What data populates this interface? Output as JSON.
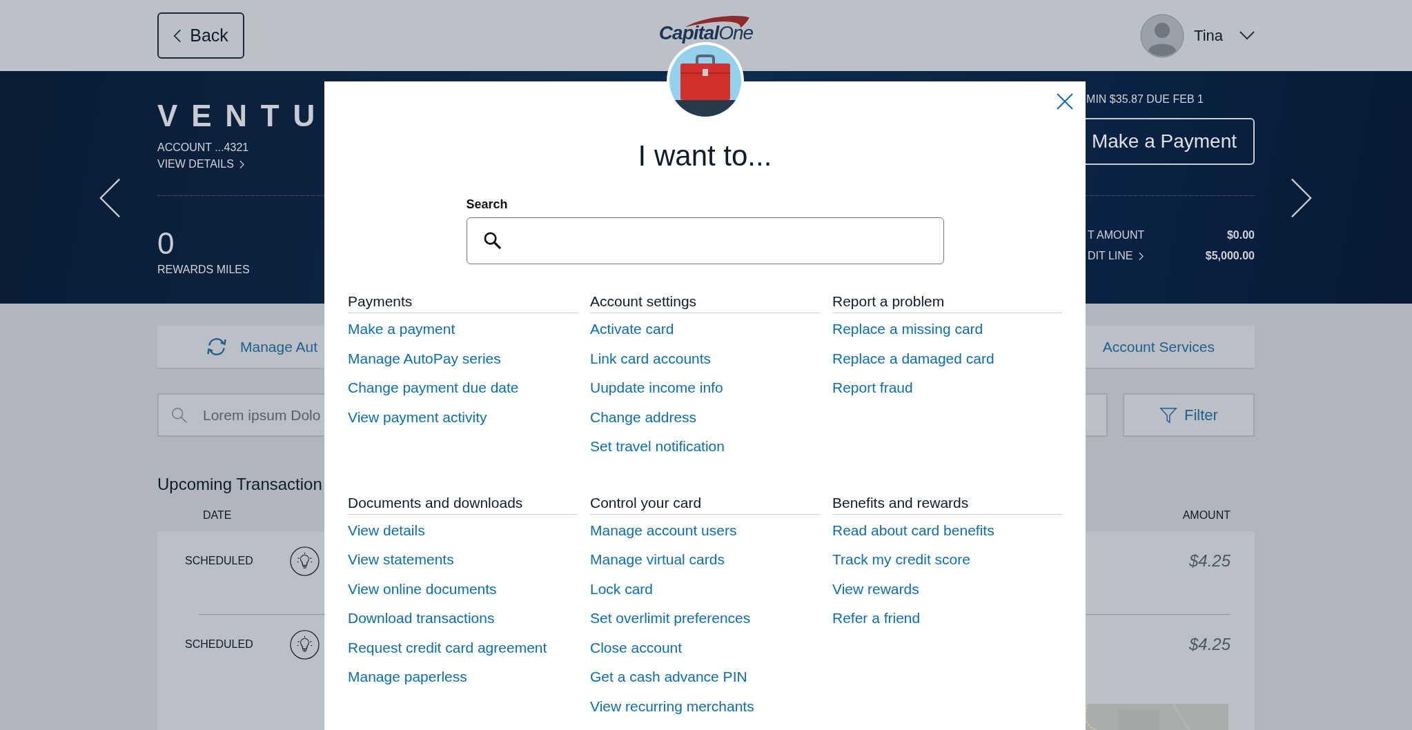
{
  "header": {
    "back": "Back",
    "logo": "**Capital**One",
    "user": "Tina"
  },
  "card": {
    "name": "VENTU",
    "account": "ACCOUNT ...4321",
    "details": "VIEW DETAILS",
    "rewards_value": "0",
    "rewards_label": "REWARDS MILES",
    "due": "MIN $35.87 DUE FEB 1",
    "pay_button": "Make a Payment",
    "rows": [
      {
        "label": "T AMOUNT",
        "value": "$0.00",
        "link": false
      },
      {
        "label": "DIT LINE",
        "value": "$5,000.00",
        "link": true
      }
    ]
  },
  "actions": {
    "left": "Manage Aut",
    "right": "Account Services"
  },
  "search": {
    "placeholder": "Lorem ipsum Dolo"
  },
  "filter": "Filter",
  "upcoming": {
    "title": "Upcoming Transaction",
    "columns": [
      "DATE",
      "AMOUNT"
    ],
    "rows": [
      {
        "date": "SCHEDULED",
        "amount": "$4.25"
      },
      {
        "date": "SCHEDULED",
        "amount": "$4.25"
      }
    ],
    "map": {
      "kind": "picture"
    }
  },
  "modal": {
    "title": "I want to...",
    "search_label": "Search",
    "sections": [
      {
        "heading": "Payments",
        "links": [
          "Make a payment",
          "Manage AutoPay series",
          "Change payment due date",
          "View payment activity"
        ]
      },
      {
        "heading": "Account settings",
        "links": [
          "Activate card",
          "Link card accounts",
          "Uupdate income info",
          "Change address",
          "Set travel notification"
        ]
      },
      {
        "heading": "Report a problem",
        "links": [
          "Replace a missing card",
          "Replace a damaged card",
          "Report fraud"
        ]
      },
      {
        "heading": "Documents and downloads",
        "links": [
          "View details",
          "View statements",
          "View online documents",
          "Download transactions",
          "Request credit card agreement",
          "Manage paperless"
        ]
      },
      {
        "heading": "Control your card",
        "links": [
          "Manage account users",
          "Manage virtual cards",
          "Lock card",
          "Set overlimit preferences",
          "Close account",
          "Get a cash advance PIN",
          "View recurring merchants"
        ]
      },
      {
        "heading": "Benefits and rewards",
        "links": [
          "Read about card benefits",
          "Track my credit score",
          "View rewards",
          "Refer a friend"
        ]
      }
    ]
  }
}
